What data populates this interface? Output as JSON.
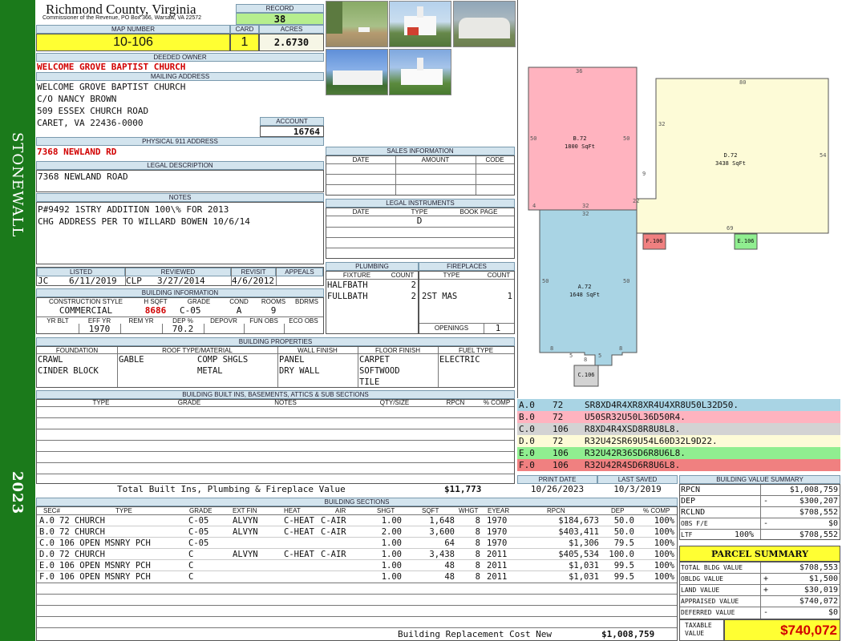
{
  "header": {
    "county": "Richmond County, Virginia",
    "commissioner": "Commissioner of the Revenue, PO Box 366, Warsaw, VA 22572",
    "record_label": "RECORD",
    "record": "38",
    "map_number_label": "MAP NUMBER",
    "map_number": "10-106",
    "card_label": "CARD",
    "card": "1",
    "acres_label": "ACRES",
    "acres": "2.6730"
  },
  "sidebar": {
    "district": "STONEWALL",
    "year": "2023"
  },
  "owner": {
    "deeded_label": "DEEDED OWNER",
    "deeded_owner": "WELCOME GROVE BAPTIST CHURCH",
    "mailing_label": "MAILING ADDRESS",
    "mailing_lines": [
      "WELCOME GROVE BAPTIST CHURCH",
      "C/O NANCY BROWN",
      "509 ESSEX CHURCH ROAD",
      "CARET, VA 22436-0000"
    ],
    "account_label": "ACCOUNT",
    "account": "16764",
    "physical_label": "PHYSICAL 911 ADDRESS",
    "physical": "7368 NEWLAND RD",
    "legal_label": "LEGAL DESCRIPTION",
    "legal": "7368 NEWLAND ROAD",
    "notes_label": "NOTES",
    "notes": [
      "P#9492 1STRY ADDITION 100\\% FOR 2013",
      "CHG ADDRESS PER TO WILLARD BOWEN 10/6/14"
    ]
  },
  "sales": {
    "label": "SALES INFORMATION",
    "cols": [
      "DATE",
      "AMOUNT",
      "CODE"
    ]
  },
  "legal_instruments": {
    "label": "LEGAL INSTRUMENTS",
    "cols": [
      "DATE",
      "TYPE",
      "BOOK PAGE"
    ],
    "type_value": "D"
  },
  "dates": {
    "listed_label": "LISTED",
    "reviewed_label": "REVIEWED",
    "revisit_label": "REVISIT",
    "appeals_label": "APPEALS",
    "listed_by": "JC",
    "listed": "6/11/2019",
    "reviewed_by": "CLP",
    "reviewed": "3/27/2014",
    "revisit": "4/6/2012"
  },
  "building_info": {
    "label": "BUILDING INFORMATION",
    "cols": [
      "CONSTRUCTION STYLE",
      "H SQFT",
      "GRADE",
      "COND",
      "ROOMS",
      "BDRMS"
    ],
    "style": "COMMERCIAL",
    "hsqft": "8686",
    "grade": "C-05",
    "cond": "A",
    "rooms": "9",
    "cols2": [
      "YR BLT",
      "EFF YR",
      "REM YR",
      "DEP %",
      "DEPOVR",
      "FUN OBS",
      "ECO OBS"
    ],
    "eff_yr": "1970",
    "dep": "70.2"
  },
  "plumbing": {
    "label": "PLUMBING",
    "cols": [
      "FIXTURE",
      "COUNT"
    ],
    "rows": [
      {
        "fixture": "HALFBATH",
        "count": "2"
      },
      {
        "fixture": "FULLBATH",
        "count": "2"
      }
    ]
  },
  "fireplaces": {
    "label": "FIREPLACES",
    "cols": [
      "TYPE",
      "COUNT"
    ],
    "rows": [
      {
        "type": "2ST MAS",
        "count": "1"
      }
    ],
    "openings_label": "OPENINGS",
    "openings": "1"
  },
  "building_props": {
    "label": "BUILDING PROPERTIES",
    "cols": [
      "FOUNDATION",
      "ROOF TYPE/MATERIAL",
      "WALL FINISH",
      "FLOOR FINISH",
      "FUEL TYPE"
    ],
    "foundation": [
      "CRAWL",
      "CINDER BLOCK"
    ],
    "roof_type": [
      "GABLE"
    ],
    "roof_material": [
      "COMP SHGLS",
      "METAL"
    ],
    "wall": [
      "PANEL",
      "DRY WALL"
    ],
    "floor": [
      "CARPET",
      "SOFTWOOD",
      "TILE"
    ],
    "fuel": [
      "ELECTRIC"
    ]
  },
  "builtins": {
    "label": "BUILDING BUILT INS, BASEMENTS, ATTICS & SUB SECTIONS",
    "cols": [
      "TYPE",
      "GRADE",
      "NOTES",
      "QTY/SIZE",
      "RPCN",
      "% COMP"
    ],
    "total_label": "Total Built Ins, Plumbing & Fireplace Value",
    "total": "$11,773"
  },
  "sketch": {
    "sections": [
      {
        "id": "A.0",
        "code": "72",
        "vector": "SR8XD4R4XR8XR4U4XR8U50L32D50.",
        "color": "#a9d4e4"
      },
      {
        "id": "B.0",
        "code": "72",
        "vector": "U50SR32U50L36D50R4.",
        "color": "#ffb3bf"
      },
      {
        "id": "C.0",
        "code": "106",
        "vector": "R8XD4R4XSD8R8U8L8.",
        "color": "#d3d3d3"
      },
      {
        "id": "D.0",
        "code": "72",
        "vector": "R32U42SR69U54L60D32L9D22.",
        "color": "#fdfbd7"
      },
      {
        "id": "E.0",
        "code": "106",
        "vector": "R32U42R36SD6R8U6L8.",
        "color": "#90ee90"
      },
      {
        "id": "F.0",
        "code": "106",
        "vector": "R32U42R4SD6R8U6L8.",
        "color": "#f08080"
      }
    ],
    "labels": {
      "b": "B.72",
      "b_sqft": "1800 SqFt",
      "d": "D.72",
      "d_sqft": "3438 SqFt",
      "a": "A.72",
      "a_sqft": "1648 SqFt",
      "c": "C.106",
      "e": "E.106",
      "f": "F.106",
      "dims": [
        "36",
        "50",
        "50",
        "32",
        "4",
        "32",
        "80",
        "32",
        "54",
        "9",
        "22",
        "69",
        "50",
        "50",
        "8",
        "5",
        "8",
        "5",
        "8"
      ]
    }
  },
  "print": {
    "print_label": "PRINT DATE",
    "saved_label": "LAST SAVED",
    "print_date": "10/26/2023",
    "last_saved": "10/3/2019"
  },
  "bldg_value_summary": {
    "label": "BUILDING VALUE SUMMARY",
    "rows": [
      {
        "k": "RPCN",
        "sign": "",
        "pct": "",
        "v": "$1,008,759"
      },
      {
        "k": "DEP",
        "sign": "-",
        "pct": "",
        "v": "$300,207"
      },
      {
        "k": "RCLND",
        "sign": "",
        "pct": "",
        "v": "$708,552"
      },
      {
        "k": "OBS F/E",
        "sign": "-",
        "pct": "",
        "v": "$0"
      },
      {
        "k": "LTF",
        "sign": "",
        "pct": "100%",
        "v": "$708,552"
      }
    ]
  },
  "building_sections": {
    "label": "BUILDING SECTIONS",
    "cols": [
      "SEC#",
      "TYPE",
      "GRADE",
      "EXT FIN",
      "HEAT",
      "AIR",
      "SHGT",
      "SQFT",
      "WHGT",
      "EYEAR",
      "RPCN",
      "DEP",
      "% COMP"
    ],
    "rows": [
      {
        "sec": "A.0",
        "type": "72 CHURCH",
        "grade": "C-05",
        "ext": "ALVYN",
        "heat": "C-HEAT",
        "air": "C-AIR",
        "shgt": "1.00",
        "sqft": "1,648",
        "whgt": "8",
        "eyear": "1970",
        "rpcn": "$184,673",
        "dep": "50.0",
        "comp": "100%"
      },
      {
        "sec": "B.0",
        "type": "72 CHURCH",
        "grade": "C-05",
        "ext": "ALVYN",
        "heat": "C-HEAT",
        "air": "C-AIR",
        "shgt": "2.00",
        "sqft": "3,600",
        "whgt": "8",
        "eyear": "1970",
        "rpcn": "$403,411",
        "dep": "50.0",
        "comp": "100%"
      },
      {
        "sec": "C.0",
        "type": "106 OPEN MSNRY PCH",
        "grade": "C-05",
        "ext": "",
        "heat": "",
        "air": "",
        "shgt": "1.00",
        "sqft": "64",
        "whgt": "8",
        "eyear": "1970",
        "rpcn": "$1,306",
        "dep": "79.5",
        "comp": "100%"
      },
      {
        "sec": "D.0",
        "type": "72 CHURCH",
        "grade": "C",
        "ext": "ALVYN",
        "heat": "C-HEAT",
        "air": "C-AIR",
        "shgt": "1.00",
        "sqft": "3,438",
        "whgt": "8",
        "eyear": "2011",
        "rpcn": "$405,534",
        "dep": "100.0",
        "comp": "100%"
      },
      {
        "sec": "E.0",
        "type": "106 OPEN MSNRY PCH",
        "grade": "C",
        "ext": "",
        "heat": "",
        "air": "",
        "shgt": "1.00",
        "sqft": "48",
        "whgt": "8",
        "eyear": "2011",
        "rpcn": "$1,031",
        "dep": "99.5",
        "comp": "100%"
      },
      {
        "sec": "F.0",
        "type": "106 OPEN MSNRY PCH",
        "grade": "C",
        "ext": "",
        "heat": "",
        "air": "",
        "shgt": "1.00",
        "sqft": "48",
        "whgt": "8",
        "eyear": "2011",
        "rpcn": "$1,031",
        "dep": "99.5",
        "comp": "100%"
      }
    ],
    "total_label": "Building Replacement Cost New",
    "total": "$1,008,759"
  },
  "parcel_summary": {
    "label": "PARCEL SUMMARY",
    "rows": [
      {
        "k": "TOTAL BLDG VALUE",
        "sign": "",
        "v": "$708,553"
      },
      {
        "k": "OBLDG VALUE",
        "sign": "+",
        "v": "$1,500"
      },
      {
        "k": "LAND VALUE",
        "sign": "+",
        "v": "$30,019"
      },
      {
        "k": "APPRAISED VALUE",
        "sign": "",
        "v": "$740,072"
      },
      {
        "k": "DEFERRED VALUE",
        "sign": "-",
        "v": "$0"
      }
    ],
    "taxable_label_1": "TAXABLE",
    "taxable_label_2": "VALUE",
    "taxable": "$740,072"
  }
}
